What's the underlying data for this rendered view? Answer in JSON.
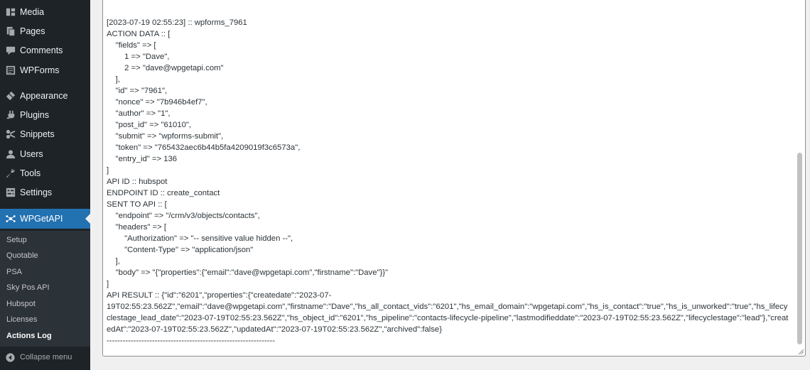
{
  "sidebar": {
    "items": [
      {
        "label": "Media",
        "icon": "media-icon"
      },
      {
        "label": "Pages",
        "icon": "pages-icon"
      },
      {
        "label": "Comments",
        "icon": "comments-icon"
      },
      {
        "label": "WPForms",
        "icon": "wpforms-icon"
      },
      {
        "label": "Appearance",
        "icon": "appearance-icon"
      },
      {
        "label": "Plugins",
        "icon": "plugins-icon"
      },
      {
        "label": "Snippets",
        "icon": "snippets-icon"
      },
      {
        "label": "Users",
        "icon": "users-icon"
      },
      {
        "label": "Tools",
        "icon": "tools-icon"
      },
      {
        "label": "Settings",
        "icon": "settings-icon"
      },
      {
        "label": "WPGetAPI",
        "icon": "wpgetapi-icon"
      }
    ],
    "submenu": [
      "Setup",
      "Quotable",
      "PSA",
      "Sky Pos API",
      "Hubspot",
      "Licenses",
      "Actions Log"
    ],
    "collapse_label": "Collapse menu"
  },
  "log": {
    "text": "[2023-07-19 02:55:23] :: wpforms_7961\nACTION DATA :: [\n    \"fields\" => [\n        1 => \"Dave\",\n        2 => \"dave@wpgetapi.com\"\n    ],\n    \"id\" => \"7961\",\n    \"nonce\" => \"7b946b4ef7\",\n    \"author\" => \"1\",\n    \"post_id\" => \"61010\",\n    \"submit\" => \"wpforms-submit\",\n    \"token\" => \"765432aec6b44b5fa4209019f3c6573a\",\n    \"entry_id\" => 136\n]\nAPI ID :: hubspot\nENDPOINT ID :: create_contact\nSENT TO API :: [\n    \"endpoint\" => \"/crm/v3/objects/contacts\",\n    \"headers\" => [\n        \"Authorization\" => \"-- sensitive value hidden --\",\n        \"Content-Type\" => \"application/json\"\n    ],\n    \"body\" => \"{\"properties\":{\"email\":\"dave@wpgetapi.com\",\"firstname\":\"Dave\"}}\"\n]\nAPI RESULT :: {\"id\":\"6201\",\"properties\":{\"createdate\":\"2023-07-\n19T02:55:23.562Z\",\"email\":\"dave@wpgetapi.com\",\"firstname\":\"Dave\",\"hs_all_contact_vids\":\"6201\",\"hs_email_domain\":\"wpgetapi.com\",\"hs_is_contact\":\"true\",\"hs_is_unworked\":\"true\",\"hs_lifecyclestage_lead_date\":\"2023-07-19T02:55:23.562Z\",\"hs_object_id\":\"6201\",\"hs_pipeline\":\"contacts-lifecycle-pipeline\",\"lastmodifieddate\":\"2023-07-19T02:55:23.562Z\",\"lifecyclestage\":\"lead\"},\"createdAt\":\"2023-07-19T02:55:23.562Z\",\"updatedAt\":\"2023-07-19T02:55:23.562Z\",\"archived\":false}\n---------------------------------------------------------------"
  },
  "colors": {
    "sidebar_bg": "#1d2327",
    "submenu_bg": "#2c3338",
    "accent": "#2271b1",
    "page_bg": "#f0f0f1"
  }
}
